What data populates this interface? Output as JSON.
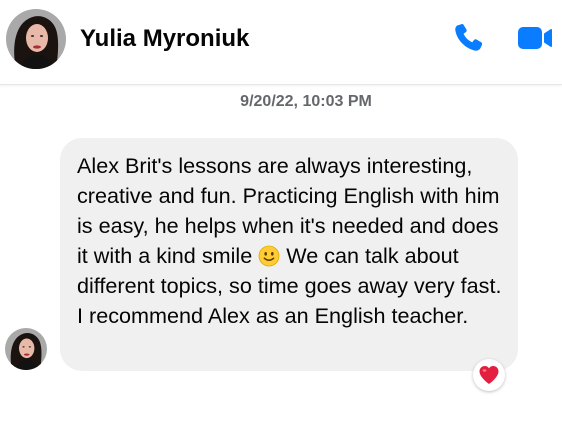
{
  "header": {
    "contact_name": "Yulia Myroniuk",
    "icons": [
      "avatar",
      "phone-icon",
      "video-camera-icon"
    ],
    "accent_color": "#0a7cff"
  },
  "conversation": {
    "timestamp": "9/20/22, 10:03 PM",
    "message": {
      "text_part1": "Alex Brit's lessons are always interesting, creative and fun. Practicing English with him is easy, he helps when it's needed and does it with a kind smile",
      "emoji": "slightly-smiling-face-emoji",
      "text_part2": "We can talk about different topics, so time goes away very fast. I recommend Alex as an English teacher.",
      "reaction": "heart-reaction"
    },
    "bubble_color": "#f0f0f0"
  }
}
